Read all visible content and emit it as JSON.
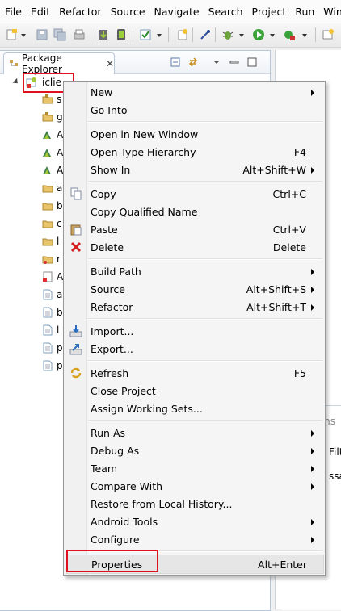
{
  "menubar": {
    "items": [
      "File",
      "Edit",
      "Refactor",
      "Source",
      "Navigate",
      "Search",
      "Project",
      "Run",
      "Win"
    ]
  },
  "toolbar": {
    "icons": [
      "new-wizard-icon",
      "save-icon",
      "save-all-icon",
      "print-icon",
      "android-sdk-icon",
      "android-avd-icon",
      "task-icon",
      "new-java-icon",
      "pin-icon",
      "debug-icon",
      "run-icon",
      "external-tools-icon",
      "open-perspective-icon"
    ]
  },
  "explorer": {
    "tab_title": "Package Explorer",
    "project_name": "iclie",
    "children": [
      {
        "text": "s",
        "icon": "src-folder-icon"
      },
      {
        "text": "g",
        "icon": "gen-folder-icon"
      },
      {
        "text": "A",
        "icon": "android-library-icon"
      },
      {
        "text": "A",
        "icon": "android-library-icon"
      },
      {
        "text": "A",
        "icon": "android-library-icon"
      },
      {
        "text": "a",
        "icon": "assets-folder-icon"
      },
      {
        "text": "b",
        "icon": "bin-folder-icon"
      },
      {
        "text": "c",
        "icon": "folder-icon"
      },
      {
        "text": "l",
        "icon": "libs-folder-icon"
      },
      {
        "text": "r",
        "icon": "res-folder-icon"
      },
      {
        "text": "A",
        "icon": "manifest-icon"
      },
      {
        "text": "a",
        "icon": "file-icon"
      },
      {
        "text": "b",
        "icon": "file-icon"
      },
      {
        "text": "l",
        "icon": "file-icon"
      },
      {
        "text": "p",
        "icon": "file-icon"
      },
      {
        "text": "p",
        "icon": "file-icon"
      }
    ]
  },
  "side_panel": {
    "tab_fragment": "ms",
    "filter_fragment": "Filte",
    "column_fragment": "ssa"
  },
  "context_menu": {
    "groups": [
      [
        {
          "label": "New",
          "accel": "",
          "submenu": true,
          "icon": ""
        },
        {
          "label": "Go Into",
          "accel": "",
          "submenu": false,
          "icon": ""
        }
      ],
      [
        {
          "label": "Open in New Window",
          "accel": "",
          "submenu": false,
          "icon": ""
        },
        {
          "label": "Open Type Hierarchy",
          "accel": "F4",
          "submenu": false,
          "icon": ""
        },
        {
          "label": "Show In",
          "accel": "Alt+Shift+W",
          "submenu": true,
          "icon": ""
        }
      ],
      [
        {
          "label": "Copy",
          "accel": "Ctrl+C",
          "submenu": false,
          "icon": "copy-icon"
        },
        {
          "label": "Copy Qualified Name",
          "accel": "",
          "submenu": false,
          "icon": ""
        },
        {
          "label": "Paste",
          "accel": "Ctrl+V",
          "submenu": false,
          "icon": "paste-icon"
        },
        {
          "label": "Delete",
          "accel": "Delete",
          "submenu": false,
          "icon": "delete-icon"
        }
      ],
      [
        {
          "label": "Build Path",
          "accel": "",
          "submenu": true,
          "icon": ""
        },
        {
          "label": "Source",
          "accel": "Alt+Shift+S",
          "submenu": true,
          "icon": ""
        },
        {
          "label": "Refactor",
          "accel": "Alt+Shift+T",
          "submenu": true,
          "icon": ""
        }
      ],
      [
        {
          "label": "Import...",
          "accel": "",
          "submenu": false,
          "icon": "import-icon"
        },
        {
          "label": "Export...",
          "accel": "",
          "submenu": false,
          "icon": "export-icon"
        }
      ],
      [
        {
          "label": "Refresh",
          "accel": "F5",
          "submenu": false,
          "icon": "refresh-icon"
        },
        {
          "label": "Close Project",
          "accel": "",
          "submenu": false,
          "icon": ""
        },
        {
          "label": "Assign Working Sets...",
          "accel": "",
          "submenu": false,
          "icon": ""
        }
      ],
      [
        {
          "label": "Run As",
          "accel": "",
          "submenu": true,
          "icon": ""
        },
        {
          "label": "Debug As",
          "accel": "",
          "submenu": true,
          "icon": ""
        },
        {
          "label": "Team",
          "accel": "",
          "submenu": true,
          "icon": ""
        },
        {
          "label": "Compare With",
          "accel": "",
          "submenu": true,
          "icon": ""
        },
        {
          "label": "Restore from Local History...",
          "accel": "",
          "submenu": false,
          "icon": ""
        },
        {
          "label": "Android Tools",
          "accel": "",
          "submenu": true,
          "icon": ""
        },
        {
          "label": "Configure",
          "accel": "",
          "submenu": true,
          "icon": ""
        }
      ],
      [
        {
          "label": "Properties",
          "accel": "Alt+Enter",
          "submenu": false,
          "icon": "",
          "highlighted": true
        }
      ]
    ]
  },
  "colors": {
    "highlight_box": "#e0101e",
    "menu_bg": "#f5f5f5"
  }
}
